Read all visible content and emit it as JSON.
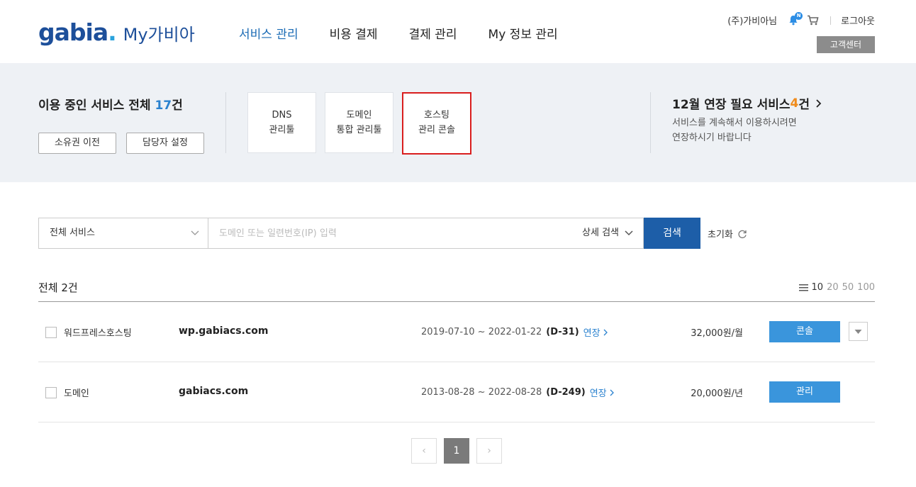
{
  "header": {
    "logo_text": "gabia",
    "logo_dot": ".",
    "logo_sub": "My가비아",
    "nav": [
      "서비스 관리",
      "비용 결제",
      "결제 관리",
      "My 정보 관리"
    ],
    "company": "(주)가비아님",
    "notification_badge": "N",
    "logout": "로그아웃",
    "customer_center": "고객센터"
  },
  "summary": {
    "total_prefix": "이용 중인 서비스 전체 ",
    "total_count": "17",
    "total_suffix": "건",
    "owner_transfer": "소유권 이전",
    "manager_setting": "담당자 설정",
    "quick_links": [
      {
        "line1": "DNS",
        "line2": "관리툴"
      },
      {
        "line1": "도메인",
        "line2": "통합 관리툴"
      },
      {
        "line1": "호스팅",
        "line2": "관리 콘솔"
      }
    ],
    "renew_prefix": "12월 연장 필요 서비스 ",
    "renew_count": "4",
    "renew_suffix": "건",
    "renew_desc1": "서비스를 계속해서 이용하시려면",
    "renew_desc2": "연장하시기 바랍니다"
  },
  "search": {
    "category": "전체 서비스",
    "placeholder": "도메인 또는 일련번호(IP) 입력",
    "advanced": "상세 검색",
    "button": "검색",
    "reset": "초기화"
  },
  "list": {
    "count_label": "전체 2건",
    "page_sizes": [
      "10",
      "20",
      "50",
      "100"
    ],
    "rows": [
      {
        "service": "워드프레스호스팅",
        "domain": "wp.gabiacs.com",
        "period": "2019-07-10 ~ 2022-01-22",
        "dday": "(D-31)",
        "extend": "연장",
        "price": "32,000원/월",
        "action": "콘솔"
      },
      {
        "service": "도메인",
        "domain": "gabiacs.com",
        "period": "2013-08-28 ~ 2022-08-28",
        "dday": "(D-249)",
        "extend": "연장",
        "price": "20,000원/년",
        "action": "관리"
      }
    ]
  },
  "pagination": {
    "prev": "‹",
    "current": "1",
    "next": "›"
  }
}
